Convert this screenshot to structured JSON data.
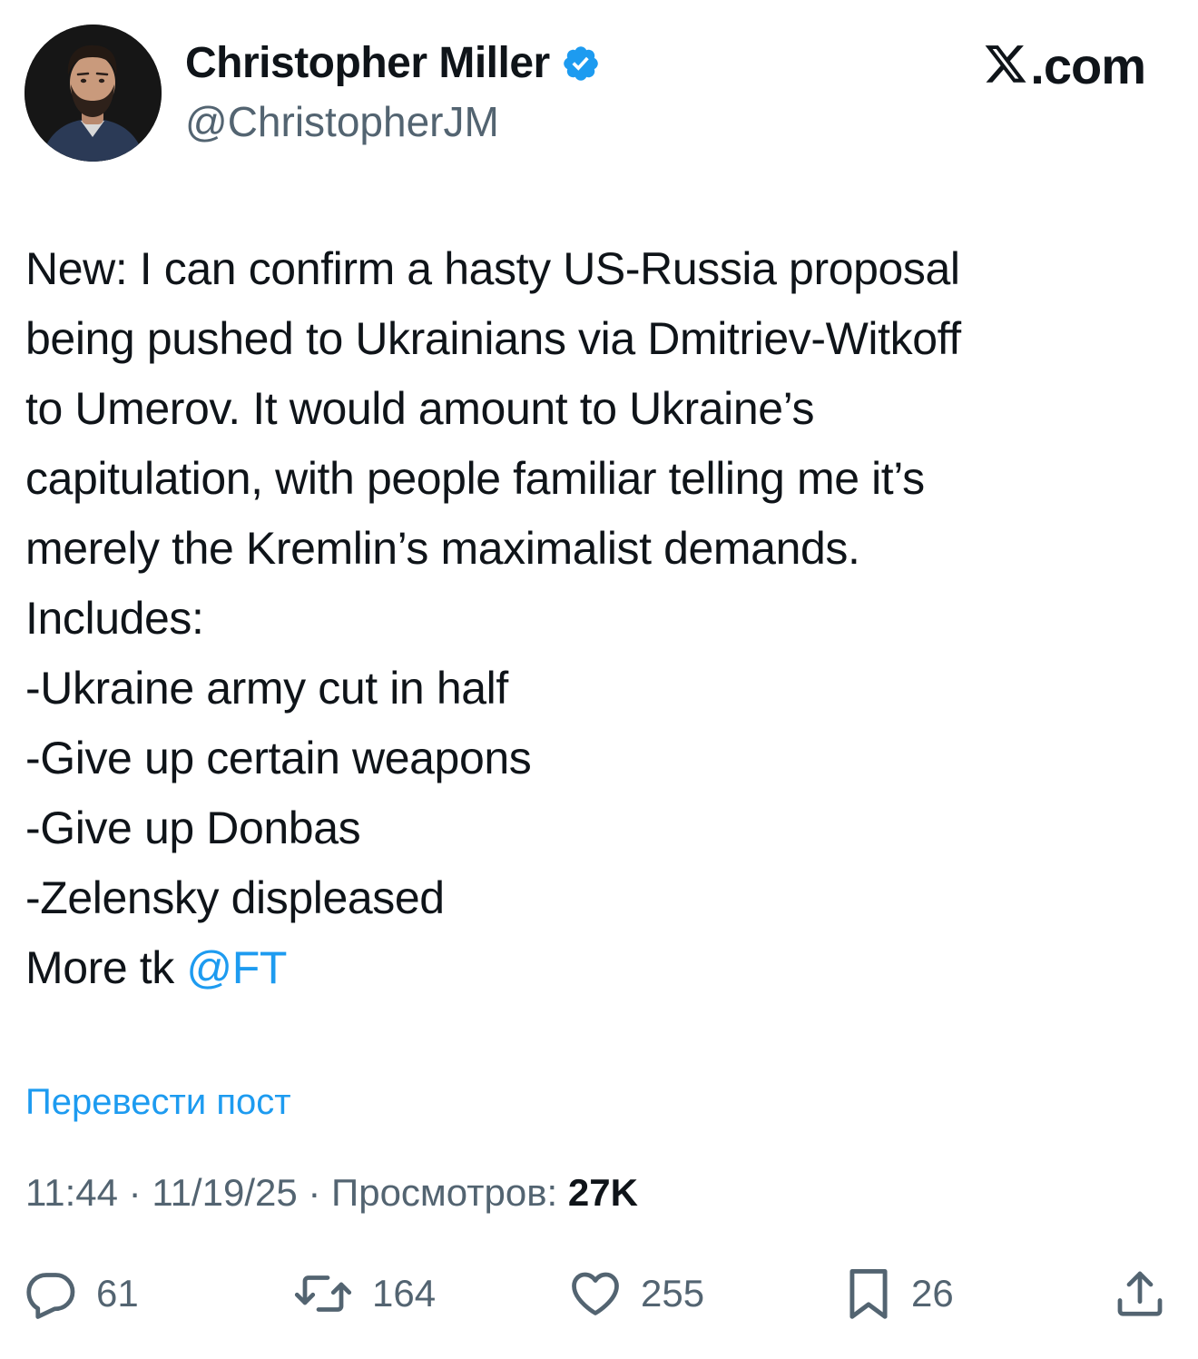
{
  "author": {
    "display_name": "Christopher Miller",
    "handle": "@ChristopherJM",
    "verified": true
  },
  "brand": {
    "logo_icon": "x-logo-icon",
    "text": ".com"
  },
  "tweet": {
    "lines": [
      "New: I can confirm a hasty US-Russia proposal",
      "being pushed to Ukrainians via Dmitriev-Witkoff",
      "to Umerov. It would amount to Ukraine’s",
      "capitulation, with people familiar telling me it’s",
      "merely the Kremlin’s maximalist demands.",
      "Includes:",
      "-Ukraine army cut in half",
      "-Give up certain weapons",
      "-Give up Donbas",
      "-Zelensky displeased"
    ],
    "last_line_prefix": "More tk ",
    "mention": "@FT"
  },
  "translate_label": "Перевести пост",
  "meta": {
    "time": "11:44",
    "sep1": " · ",
    "date": "11/19/25",
    "sep2": " · ",
    "views_label": "Просмотров: ",
    "views_count": "27K"
  },
  "actions": {
    "replies": "61",
    "reposts": "164",
    "likes": "255",
    "bookmarks": "26"
  },
  "colors": {
    "accent": "#1d9bf0",
    "secondary_text": "#536471",
    "primary_text": "#0f1419"
  }
}
